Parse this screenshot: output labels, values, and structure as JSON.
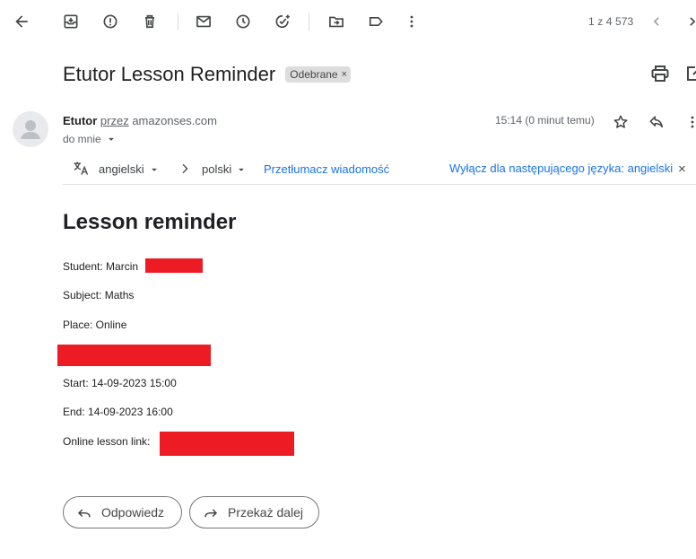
{
  "toolbar": {
    "icons": [
      "back-arrow-icon",
      "archive-icon",
      "report-spam-icon",
      "delete-icon",
      "mark-unread-icon",
      "snooze-icon",
      "add-task-icon",
      "move-to-icon",
      "label-icon",
      "more-vert-icon"
    ],
    "pager_text": "1 z 4 573"
  },
  "email": {
    "subject": "Etutor Lesson Reminder",
    "label": "Odebrane",
    "label_remove": "×",
    "sender_name": "Etutor",
    "via_text": "przez",
    "via_domain": "amazonses.com",
    "to_text": "do mnie",
    "time": "15:14 (0 minut temu)"
  },
  "translate": {
    "from_lang": "angielski",
    "to_lang": "polski",
    "translate_link": "Przetłumacz wiadomość",
    "disable_link": "Wyłącz dla następującego języka: angielski",
    "close": "×"
  },
  "body": {
    "title": "Lesson reminder",
    "student": "Student: Marcin",
    "subject_line": "Subject: Maths",
    "place": "Place: Online",
    "start": "Start: 14-09-2023 15:00",
    "end": "End: 14-09-2023 16:00",
    "link_label": "Online lesson link:"
  },
  "actions": {
    "reply": "Odpowiedz",
    "forward": "Przekaż dalej"
  },
  "colors": {
    "link": "#1a73e8",
    "redaction": "#ed1c24",
    "icon": "#444746"
  }
}
